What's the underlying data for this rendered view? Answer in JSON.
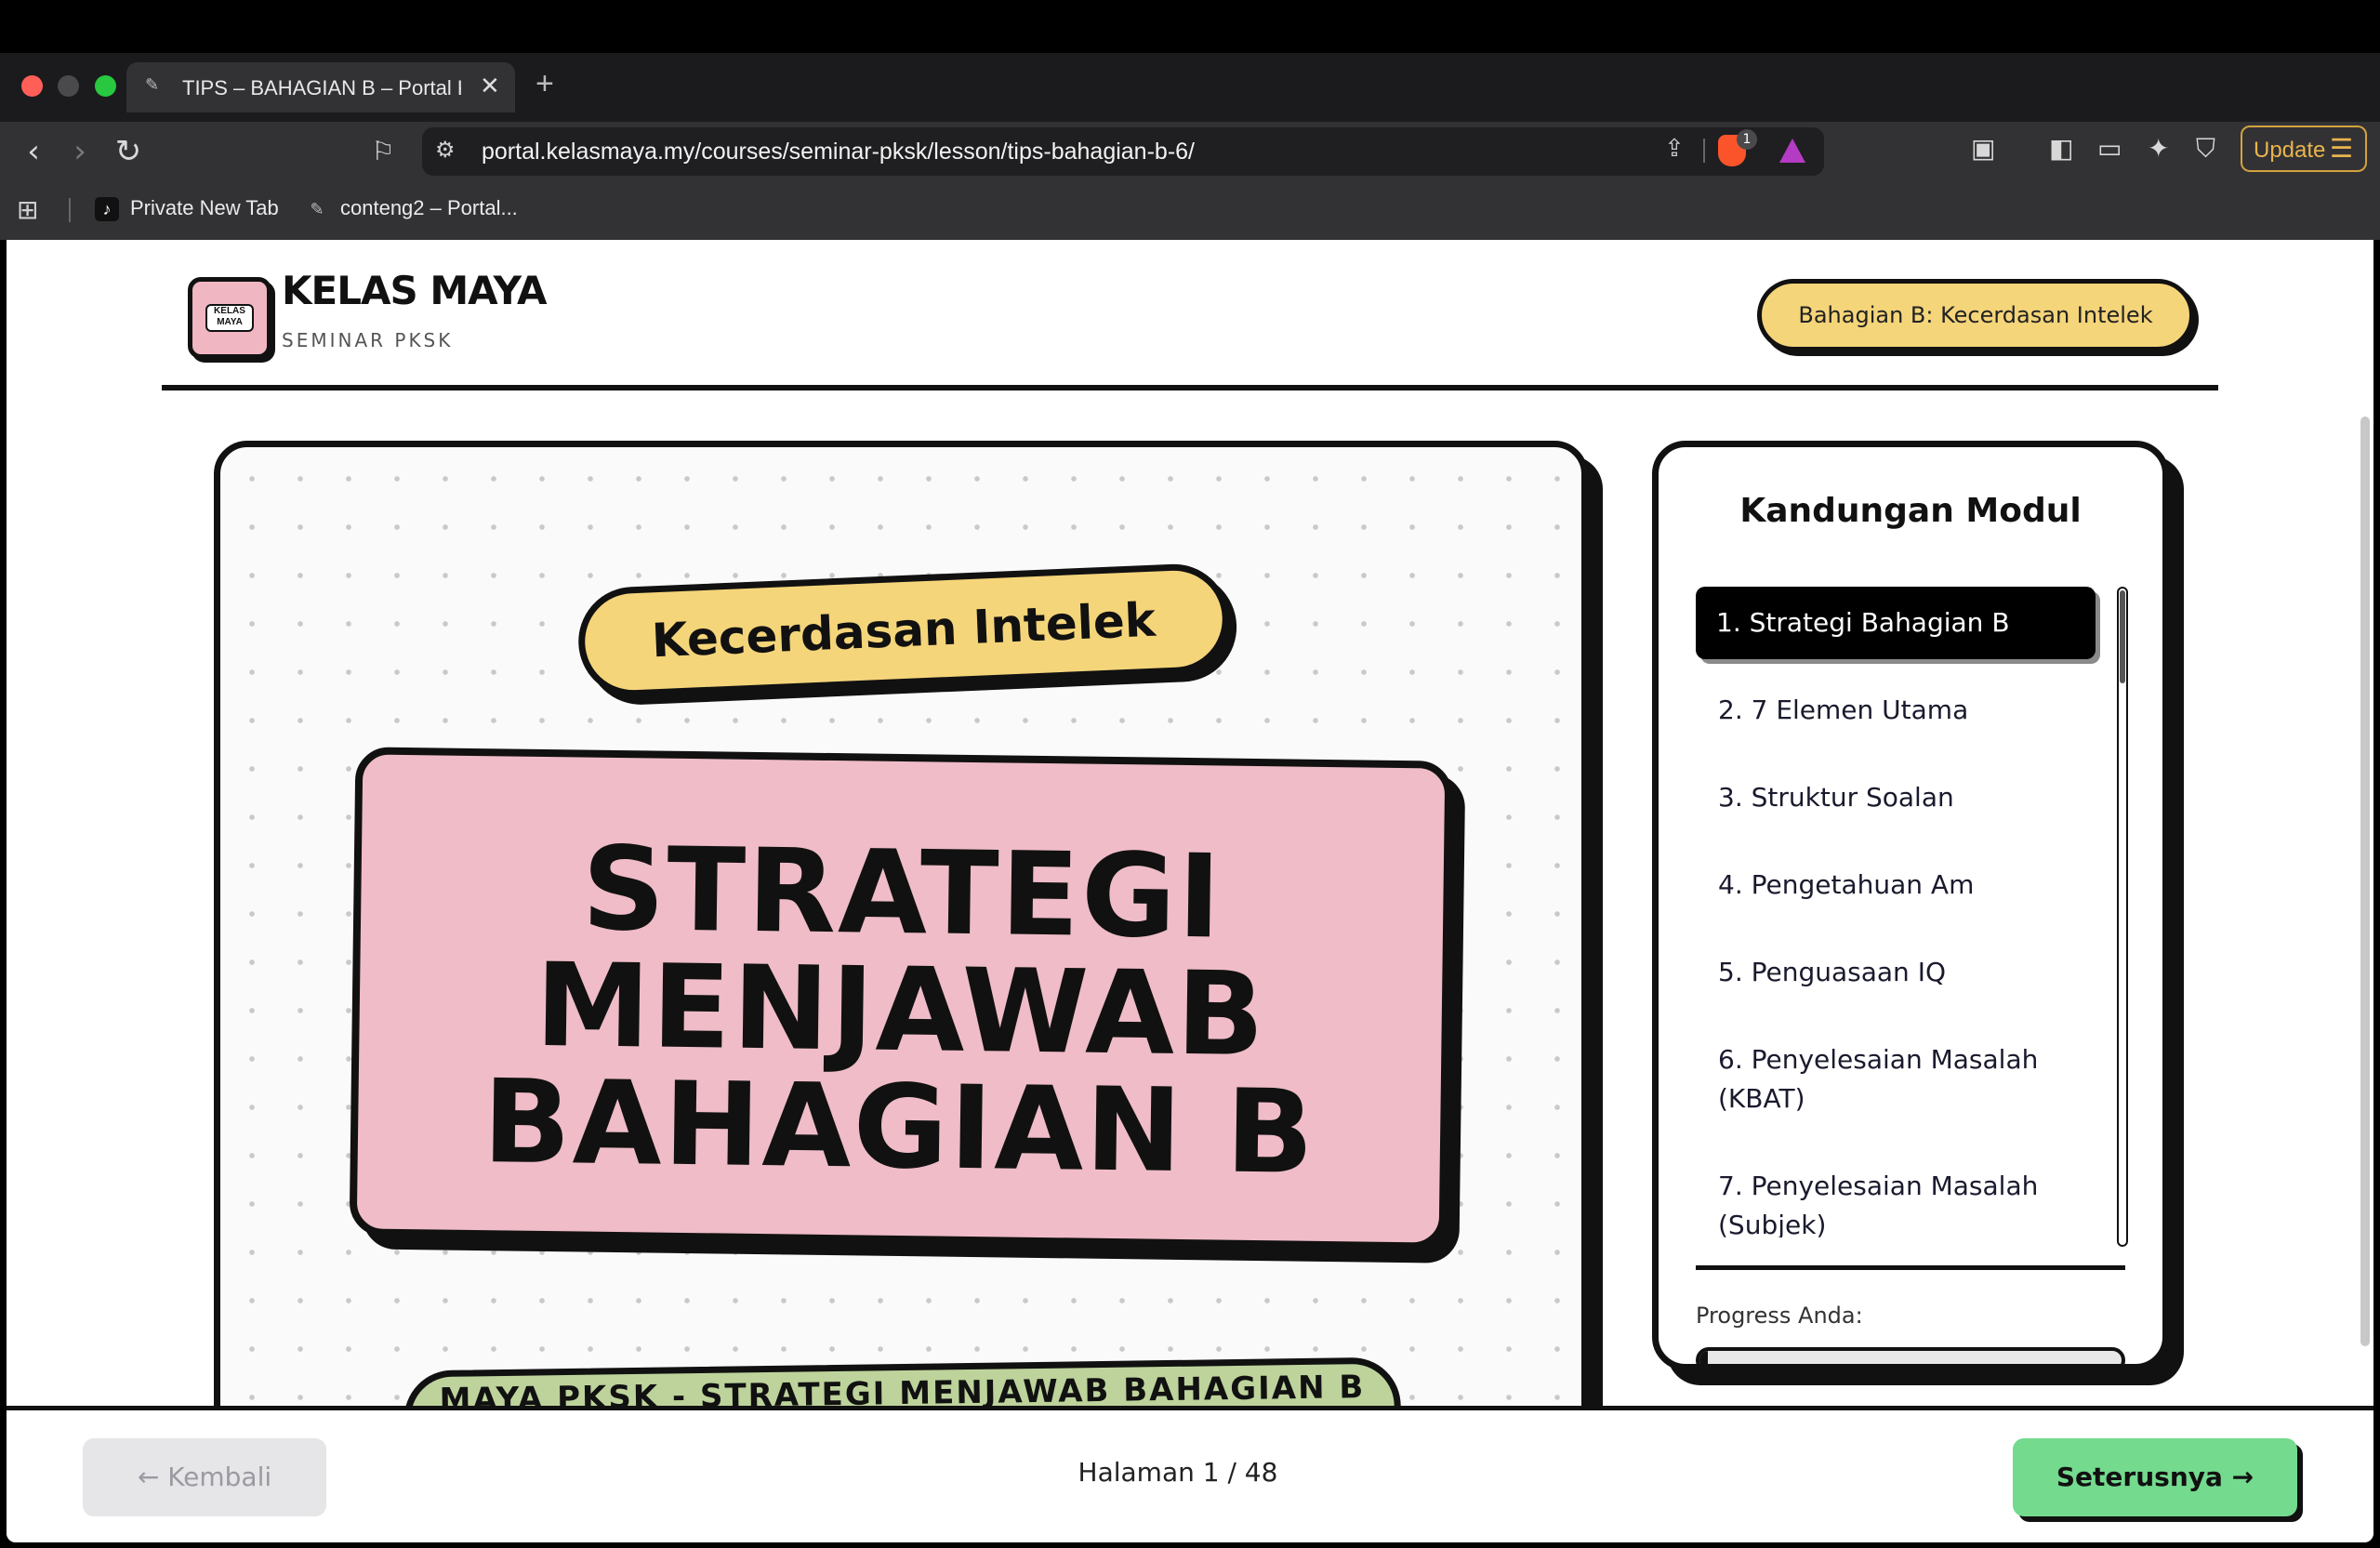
{
  "browser": {
    "tab_title": "TIPS – BAHAGIAN B – Portal K",
    "tab_close": "✕",
    "new_tab": "+",
    "url": "portal.kelasmaya.my/courses/seminar-pksk/lesson/tips-bahagian-b-6/",
    "brave_badge": "1",
    "update_label": "Update",
    "bookmarks": [
      {
        "label": "Private New Tab",
        "icon": "tiktok-icon"
      },
      {
        "label": "conteng2 – Portal...",
        "icon": "stamp-icon"
      }
    ]
  },
  "header": {
    "brand_name": "KELAS MAYA",
    "brand_sub": "SEMINAR PKSK",
    "logo_text": "KELAS MAYA",
    "section_label": "Bahagian B: Kecerdasan Intelek"
  },
  "slide": {
    "topic": "Kecerdasan Intelek",
    "title_lines": [
      "STRATEGI",
      "MENJAWAB",
      "BAHAGIAN B"
    ],
    "subtitle": "MAYA PKSK - STRATEGI MENJAWAB BAHAGIAN B"
  },
  "sidebar": {
    "title": "Kandungan Modul",
    "items": [
      "1. Strategi Bahagian B",
      "2. 7 Elemen Utama",
      "3. Struktur Soalan",
      "4. Pengetahuan Am",
      "5. Penguasaan IQ",
      "6. Penyelesaian Masalah (KBAT)",
      "7. Penyelesaian Masalah (Subjek)"
    ],
    "active_index": 0,
    "progress_label": "Progress Anda:",
    "progress_fraction": 0.02
  },
  "footer": {
    "back_label": "← Kembali",
    "page_indicator": "Halaman 1 / 48",
    "next_label": "Seterusnya →"
  },
  "colors": {
    "accent_yellow": "#f5d57a",
    "title_pink": "#efbcc7",
    "subtitle_green": "#bdd39b",
    "next_green": "#73da8e",
    "ink": "#111111"
  }
}
